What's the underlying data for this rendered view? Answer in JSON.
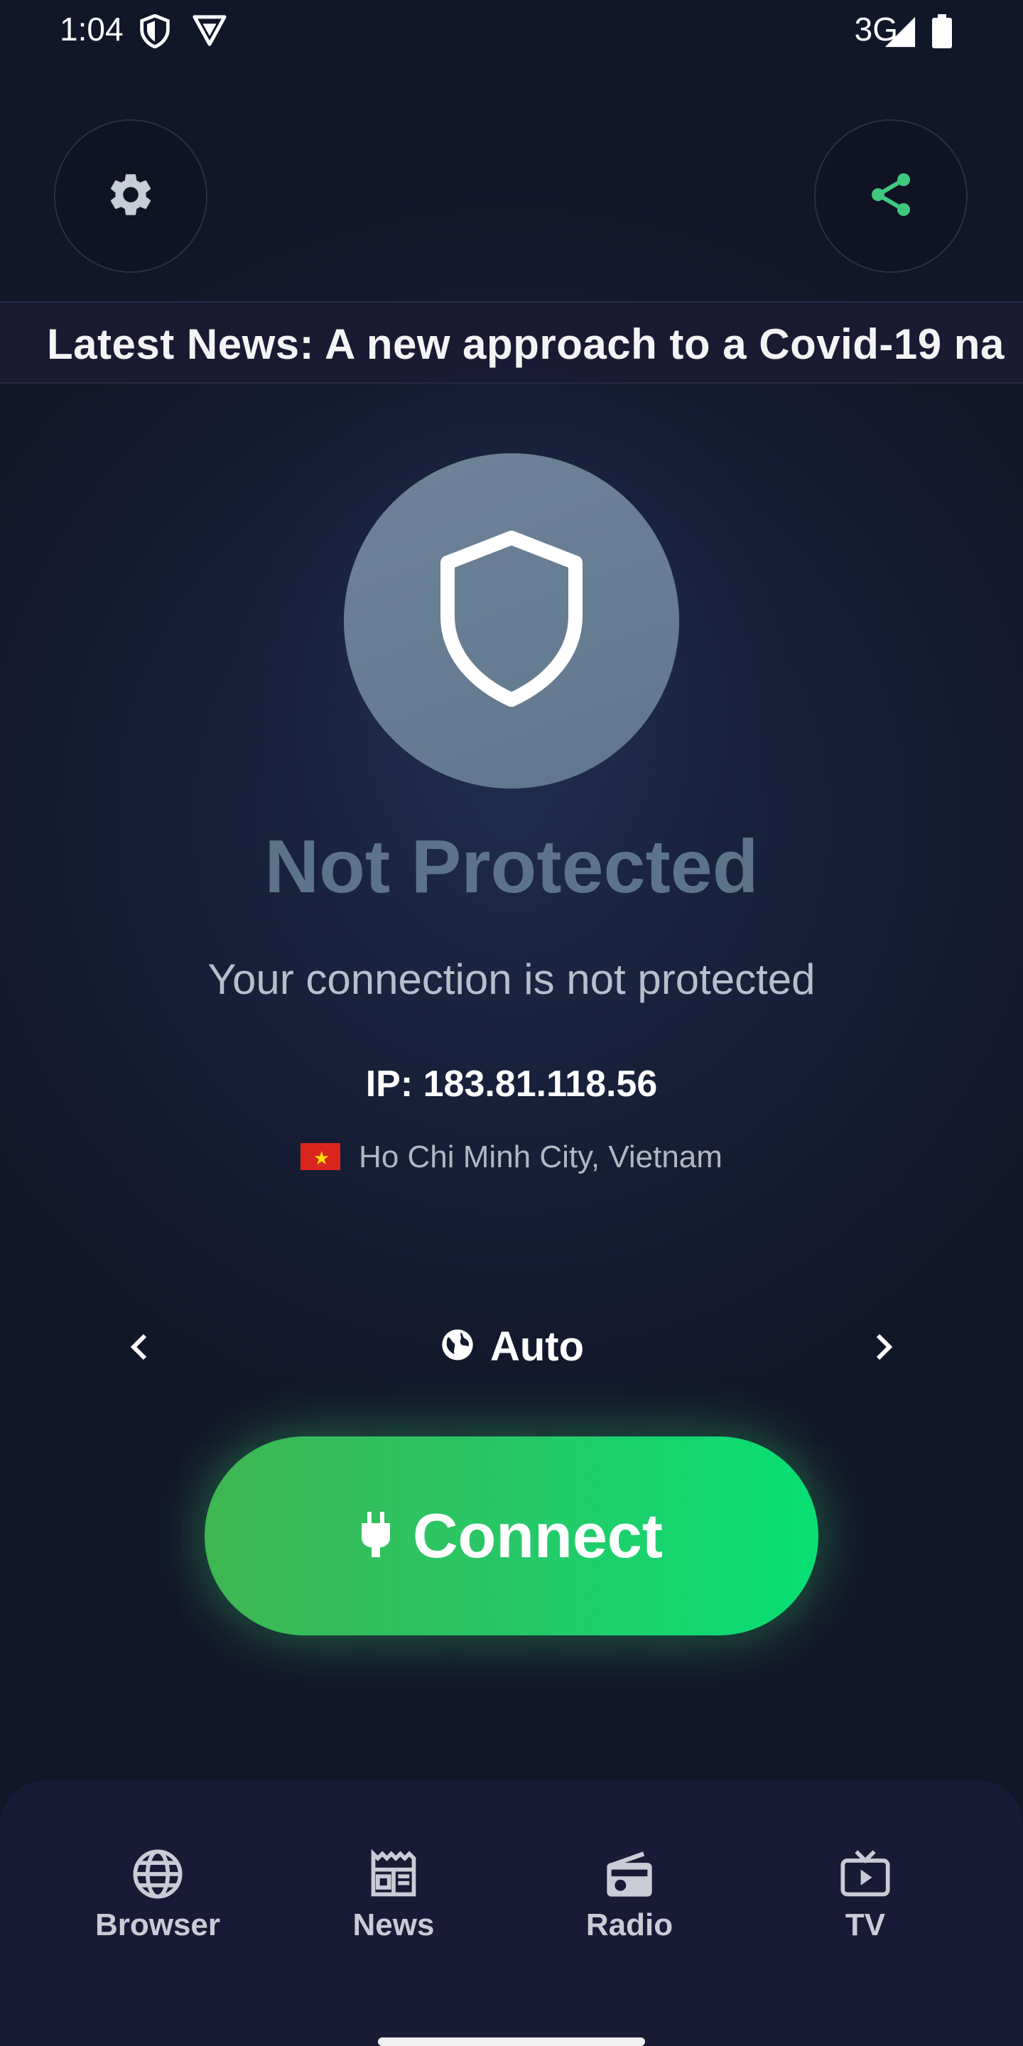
{
  "status_bar": {
    "time": "1:04",
    "network": "3G"
  },
  "header": {
    "settings_icon": "gear-icon",
    "share_icon": "share-icon"
  },
  "ticker": {
    "text": "Latest News: A new approach to a Covid-19 na"
  },
  "protection": {
    "title": "Not Protected",
    "subtitle": "Your connection is not protected",
    "ip": "IP: 183.81.118.56",
    "location": "Ho Chi Minh City, Vietnam"
  },
  "server": {
    "label": "Auto"
  },
  "connect": {
    "label": "Connect"
  },
  "nav": [
    {
      "label": "Browser",
      "icon": "globe-icon"
    },
    {
      "label": "News",
      "icon": "newspaper-icon"
    },
    {
      "label": "Radio",
      "icon": "radio-icon"
    },
    {
      "label": "TV",
      "icon": "tv-icon"
    }
  ],
  "colors": {
    "accent_green": "#2ecc6a",
    "status_title": "#5c7489",
    "share_icon": "#3ec97e"
  }
}
